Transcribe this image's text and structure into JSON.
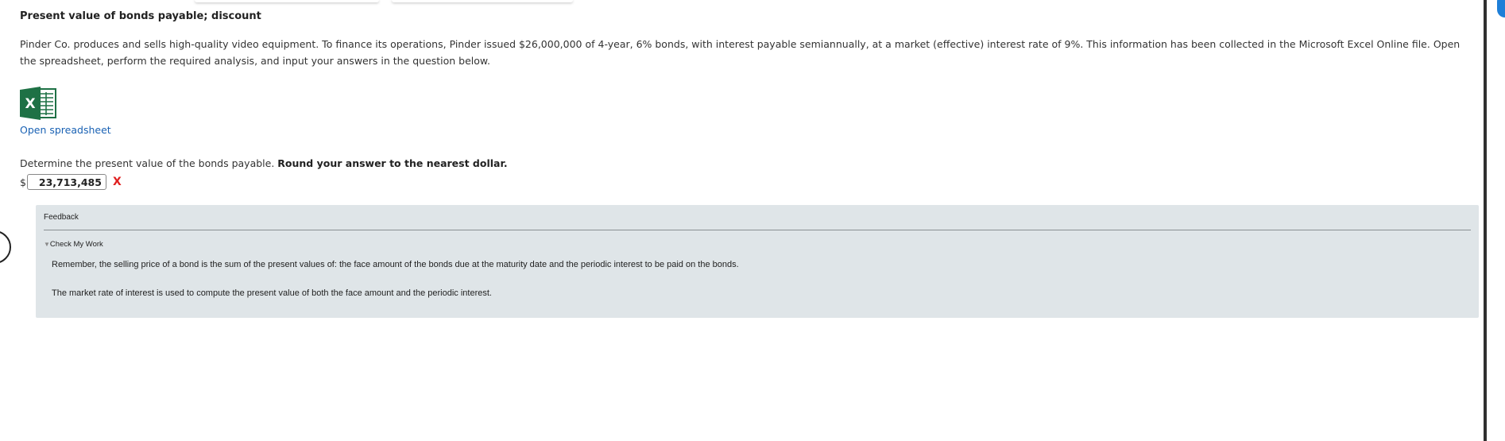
{
  "problem": {
    "title": "Present value of bonds payable; discount",
    "description": "Pinder Co. produces and sells high-quality video equipment. To finance its operations, Pinder issued $26,000,000 of 4-year, 6% bonds, with interest payable semiannually, at a market (effective) interest rate of 9%. This information has been collected in the Microsoft Excel Online file. Open the spreadsheet, perform the required analysis, and input your answers in the question below.",
    "spreadsheet_link": "Open spreadsheet",
    "spreadsheet_icon": "excel-icon"
  },
  "question": {
    "prompt": "Determine the present value of the bonds payable.",
    "instruction": "Round your answer to the nearest dollar.",
    "currency": "$",
    "answer_value": "23,713,485",
    "result_mark": "X"
  },
  "feedback": {
    "title": "Feedback",
    "section_label": "Check My Work",
    "paragraph1": "Remember, the selling price of a bond is the sum of the present values of: the face amount of the bonds due at the maturity date and the periodic interest to be paid on the bonds.",
    "paragraph2": "The market rate of interest is used to compute the present value of both the face amount and the periodic interest."
  },
  "colors": {
    "link": "#1a62b4",
    "error": "#e02020",
    "feedback_bg": "#dfe5e8",
    "excel_green": "#1e7145"
  }
}
